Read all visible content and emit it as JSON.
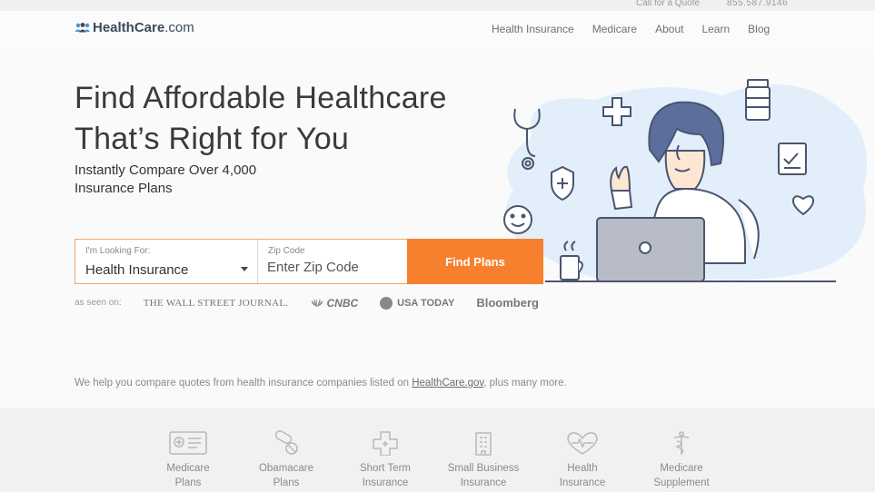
{
  "topbar": {
    "call_label": "Call for a Quote",
    "phone": "855.587.9146"
  },
  "brand": {
    "name": "HealthCare",
    "suffix": ".com"
  },
  "nav": [
    "Health Insurance",
    "Medicare",
    "About",
    "Learn",
    "Blog"
  ],
  "hero": {
    "title_line1": "Find Affordable Healthcare",
    "title_line2": "That’s Right for You",
    "subtitle_line1": "Instantly Compare Over 4,000",
    "subtitle_line2": "Insurance Plans"
  },
  "form": {
    "looking_label": "I'm Looking For:",
    "looking_value": "Health Insurance",
    "zip_label": "Zip Code",
    "zip_placeholder": "Enter Zip Code",
    "button_label": "Find Plans"
  },
  "as_seen_on": {
    "label": "as seen on:",
    "outlets": [
      "THE WALL STREET JOURNAL.",
      "CNBC",
      "USA TODAY",
      "Bloomberg"
    ]
  },
  "compare_note": {
    "before": "We help you compare quotes from health insurance companies listed on ",
    "link": "HealthCare.gov",
    "after": ", plus many more."
  },
  "categories": [
    {
      "line1": "Medicare",
      "line2": "Plans",
      "icon": "medicare-card-icon"
    },
    {
      "line1": "Obamacare",
      "line2": "Plans",
      "icon": "pills-icon"
    },
    {
      "line1": "Short Term",
      "line2": "Insurance",
      "icon": "medical-cross-icon"
    },
    {
      "line1": "Small Business",
      "line2": "Insurance",
      "icon": "building-icon"
    },
    {
      "line1": "Health",
      "line2": "Insurance",
      "icon": "heart-pulse-icon"
    },
    {
      "line1": "Medicare",
      "line2": "Supplement",
      "icon": "caduceus-icon"
    }
  ],
  "colors": {
    "accent": "#f7802f",
    "brand": "#3d4a5c",
    "hero_blob": "#e3eefb",
    "illustration_stroke": "#4a5570",
    "hair": "#5c6f9c",
    "laptop": "#b8bcc6"
  }
}
